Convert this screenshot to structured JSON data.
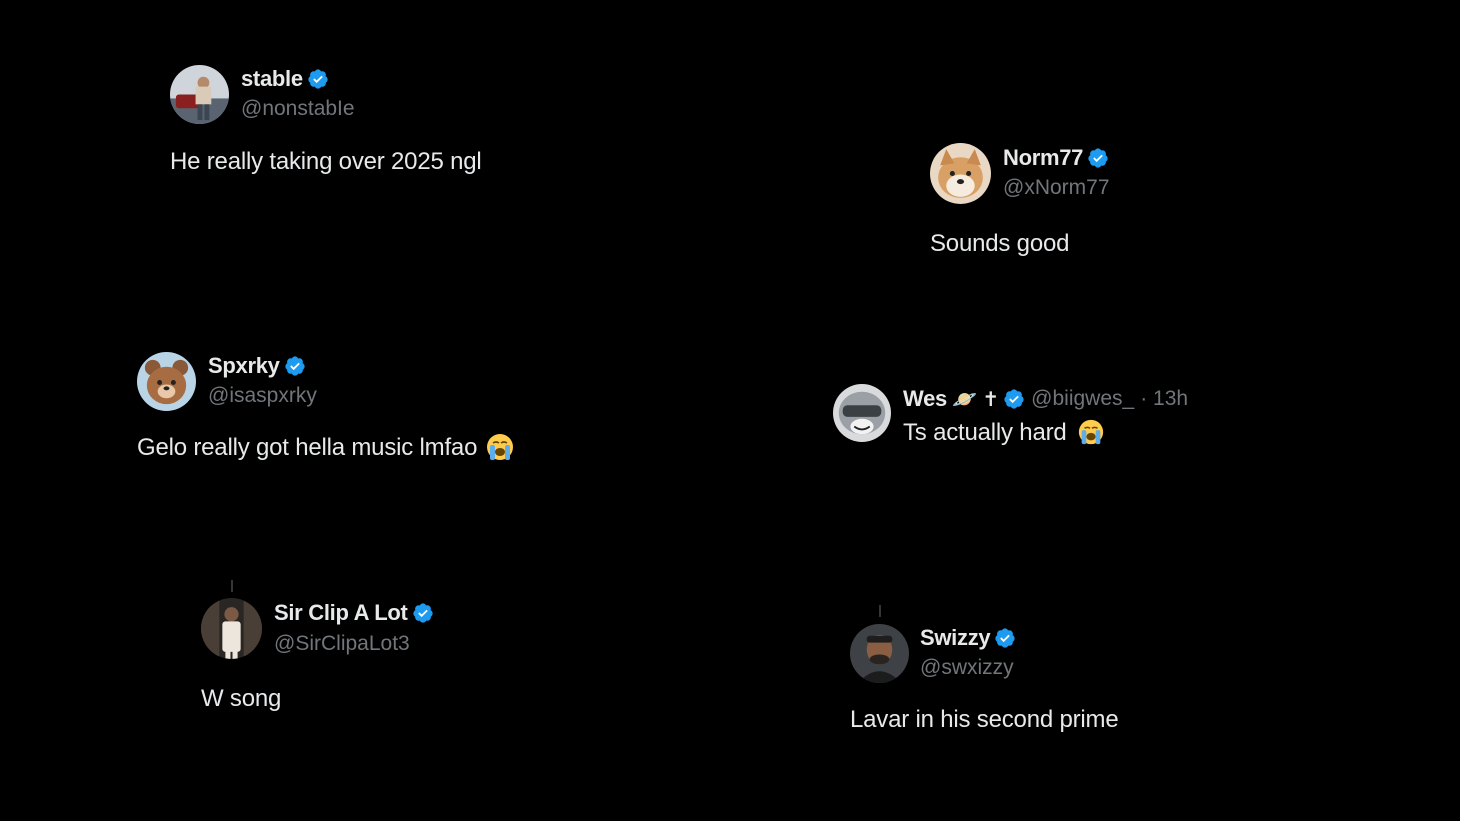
{
  "tweets": [
    {
      "name": "stable",
      "handle": "@nonstabIe",
      "text": "He really taking over 2025 ngl",
      "avatar_icon": "person-car-avatar"
    },
    {
      "name": "Norm77",
      "handle": "@xNorm77",
      "text": "Sounds good",
      "avatar_icon": "shiba-dog-avatar"
    },
    {
      "name": "Spxrky",
      "handle": "@isaspxrky",
      "text": "Gelo really got hella music lmfao",
      "avatar_icon": "bear-avatar"
    },
    {
      "name": "Wes",
      "name_suffix": "🪐 ✝",
      "handle": "@biigwes_",
      "time": "· 13h",
      "text": "Ts actually hard",
      "avatar_icon": "helmet-character-avatar"
    },
    {
      "name": "Sir Clip A Lot",
      "handle": "@SirClipaLot3",
      "text": "W song",
      "avatar_icon": "person-white-outfit-avatar"
    },
    {
      "name": "Swizzy",
      "handle": "@swxizzy",
      "text": "Lavar in his second prime",
      "avatar_icon": "man-portrait-avatar"
    }
  ],
  "colors": {
    "background": "#000000",
    "name": "#e7e9ea",
    "handle": "#71767b",
    "verified": "#1d9bf0"
  }
}
